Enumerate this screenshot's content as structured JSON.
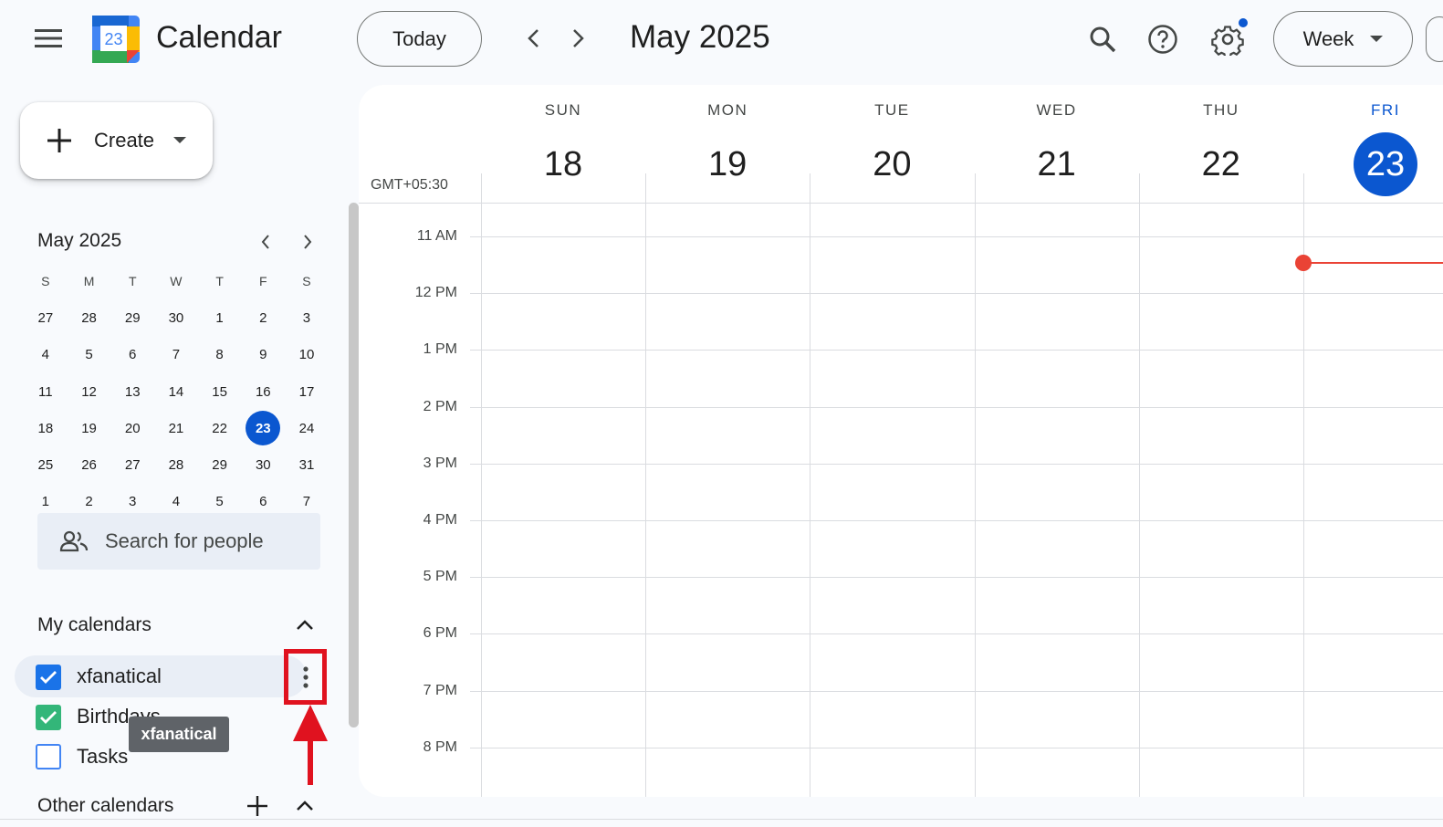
{
  "header": {
    "app_title": "Calendar",
    "logo_day": "23",
    "today_label": "Today",
    "period_title": "May 2025",
    "view_label": "Week"
  },
  "sidebar": {
    "create_label": "Create",
    "mini_calendar": {
      "title": "May 2025",
      "dow": [
        "S",
        "M",
        "T",
        "W",
        "T",
        "F",
        "S"
      ],
      "weeks": [
        [
          "27",
          "28",
          "29",
          "30",
          "1",
          "2",
          "3"
        ],
        [
          "4",
          "5",
          "6",
          "7",
          "8",
          "9",
          "10"
        ],
        [
          "11",
          "12",
          "13",
          "14",
          "15",
          "16",
          "17"
        ],
        [
          "18",
          "19",
          "20",
          "21",
          "22",
          "23",
          "24"
        ],
        [
          "25",
          "26",
          "27",
          "28",
          "29",
          "30",
          "31"
        ],
        [
          "1",
          "2",
          "3",
          "4",
          "5",
          "6",
          "7"
        ]
      ],
      "today": "23"
    },
    "search_people_placeholder": "Search for people",
    "my_calendars_title": "My calendars",
    "calendars": [
      {
        "label": "xfanatical",
        "color": "#1a73e8",
        "checked": true
      },
      {
        "label": "Birthdays",
        "color": "#33b679",
        "checked": true
      },
      {
        "label": "Tasks",
        "color": "#4285f4",
        "checked": false
      }
    ],
    "tooltip": "xfanatical",
    "other_calendars_title": "Other calendars"
  },
  "week": {
    "timezone": "GMT+05:30",
    "days": [
      {
        "dow": "SUN",
        "num": "18"
      },
      {
        "dow": "MON",
        "num": "19"
      },
      {
        "dow": "TUE",
        "num": "20"
      },
      {
        "dow": "WED",
        "num": "21"
      },
      {
        "dow": "THU",
        "num": "22"
      },
      {
        "dow": "FRI",
        "num": "23"
      }
    ],
    "today_index": 5,
    "hours": [
      "11 AM",
      "12 PM",
      "1 PM",
      "2 PM",
      "3 PM",
      "4 PM",
      "5 PM",
      "6 PM",
      "7 PM",
      "8 PM"
    ]
  },
  "colors": {
    "accent": "#0b57d0",
    "now_indicator": "#ea4335",
    "highlight_box": "#e0121f"
  },
  "icons": [
    "menu-icon",
    "calendar-logo-icon",
    "chevron-left-icon",
    "chevron-right-icon",
    "search-icon",
    "help-icon",
    "gear-icon",
    "caret-down-icon",
    "plus-icon",
    "people-icon",
    "chevron-up-icon",
    "more-vert-icon",
    "checkmark-icon"
  ]
}
